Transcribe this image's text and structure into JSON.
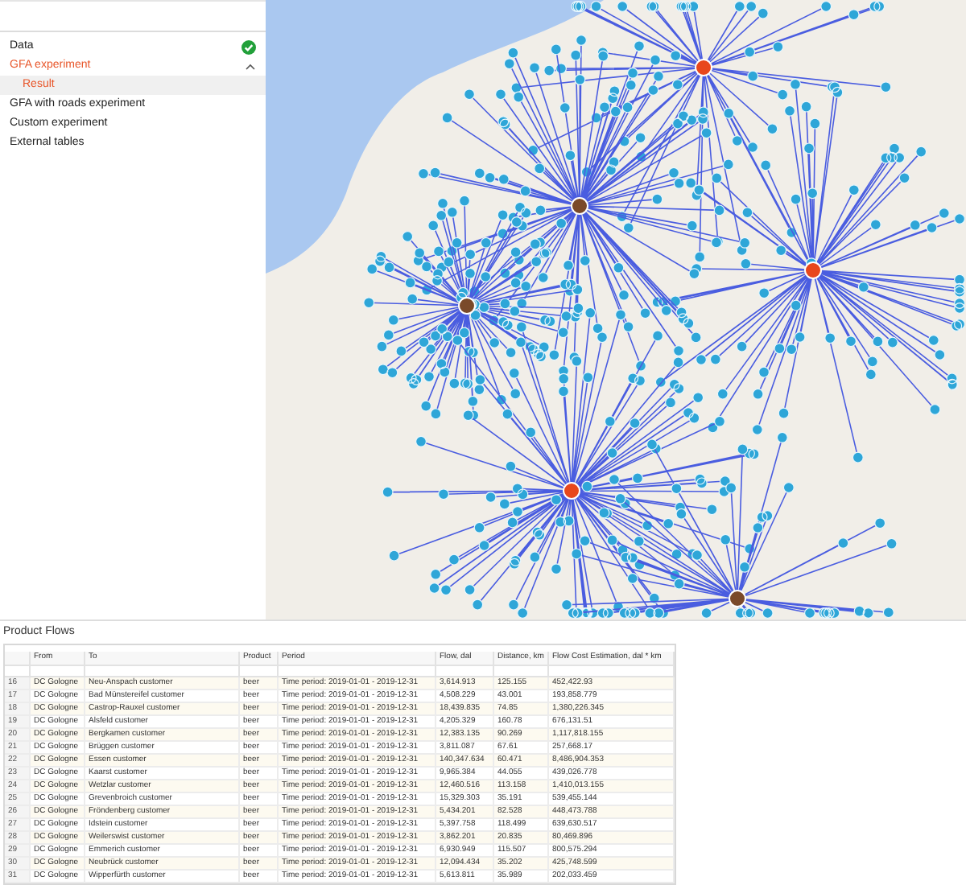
{
  "sidebar": {
    "items": [
      {
        "label": "Data",
        "kind": "status",
        "selected": false
      },
      {
        "label": "GFA experiment",
        "kind": "group",
        "selected": true,
        "expanded": true,
        "children": [
          {
            "label": "Result",
            "selected": true
          }
        ]
      },
      {
        "label": "GFA with roads experiment",
        "kind": "plain",
        "selected": false
      },
      {
        "label": "Custom experiment",
        "kind": "plain",
        "selected": false
      },
      {
        "label": "External tables",
        "kind": "plain",
        "selected": false
      }
    ]
  },
  "table": {
    "title": "Product Flows",
    "columns": [
      "",
      "From",
      "To",
      "Product",
      "Period",
      "Flow, dal",
      "Distance, km",
      "Flow Cost Estimation, dal * km"
    ],
    "rows": [
      [
        "16",
        "DC Gologne",
        "Neu-Anspach customer",
        "beer",
        "Time period: 2019-01-01 - 2019-12-31",
        "3,614.913",
        "125.155",
        "452,422.93"
      ],
      [
        "17",
        "DC Gologne",
        "Bad Münstereifel customer",
        "beer",
        "Time period: 2019-01-01 - 2019-12-31",
        "4,508.229",
        "43.001",
        "193,858.779"
      ],
      [
        "18",
        "DC Gologne",
        "Castrop-Rauxel customer",
        "beer",
        "Time period: 2019-01-01 - 2019-12-31",
        "18,439.835",
        "74.85",
        "1,380,226.345"
      ],
      [
        "19",
        "DC Gologne",
        "Alsfeld customer",
        "beer",
        "Time period: 2019-01-01 - 2019-12-31",
        "4,205.329",
        "160.78",
        "676,131.51"
      ],
      [
        "20",
        "DC Gologne",
        "Bergkamen customer",
        "beer",
        "Time period: 2019-01-01 - 2019-12-31",
        "12,383.135",
        "90.269",
        "1,117,818.155"
      ],
      [
        "21",
        "DC Gologne",
        "Brüggen customer",
        "beer",
        "Time period: 2019-01-01 - 2019-12-31",
        "3,811.087",
        "67.61",
        "257,668.17"
      ],
      [
        "22",
        "DC Gologne",
        "Essen customer",
        "beer",
        "Time period: 2019-01-01 - 2019-12-31",
        "140,347.634",
        "60.471",
        "8,486,904.353"
      ],
      [
        "23",
        "DC Gologne",
        "Kaarst customer",
        "beer",
        "Time period: 2019-01-01 - 2019-12-31",
        "9,965.384",
        "44.055",
        "439,026.778"
      ],
      [
        "24",
        "DC Gologne",
        "Wetzlar customer",
        "beer",
        "Time period: 2019-01-01 - 2019-12-31",
        "12,460.516",
        "113.158",
        "1,410,013.155"
      ],
      [
        "25",
        "DC Gologne",
        "Grevenbroich customer",
        "beer",
        "Time period: 2019-01-01 - 2019-12-31",
        "15,329.303",
        "35.191",
        "539,455.144"
      ],
      [
        "26",
        "DC Gologne",
        "Fröndenberg customer",
        "beer",
        "Time period: 2019-01-01 - 2019-12-31",
        "5,434.201",
        "82.528",
        "448,473.788"
      ],
      [
        "27",
        "DC Gologne",
        "Idstein customer",
        "beer",
        "Time period: 2019-01-01 - 2019-12-31",
        "5,397.758",
        "118.499",
        "639,630.517"
      ],
      [
        "28",
        "DC Gologne",
        "Weilerswist customer",
        "beer",
        "Time period: 2019-01-01 - 2019-12-31",
        "3,862.201",
        "20.835",
        "80,469.896"
      ],
      [
        "29",
        "DC Gologne",
        "Emmerich customer",
        "beer",
        "Time period: 2019-01-01 - 2019-12-31",
        "6,930.949",
        "115.507",
        "800,575.294"
      ],
      [
        "30",
        "DC Gologne",
        "Neubrück customer",
        "beer",
        "Time period: 2019-01-01 - 2019-12-31",
        "12,094.434",
        "35.202",
        "425,748.599"
      ],
      [
        "31",
        "DC Gologne",
        "Wipperfürth customer",
        "beer",
        "Time period: 2019-01-01 - 2019-12-31",
        "5,613.811",
        "35.989",
        "202,033.459"
      ]
    ]
  }
}
